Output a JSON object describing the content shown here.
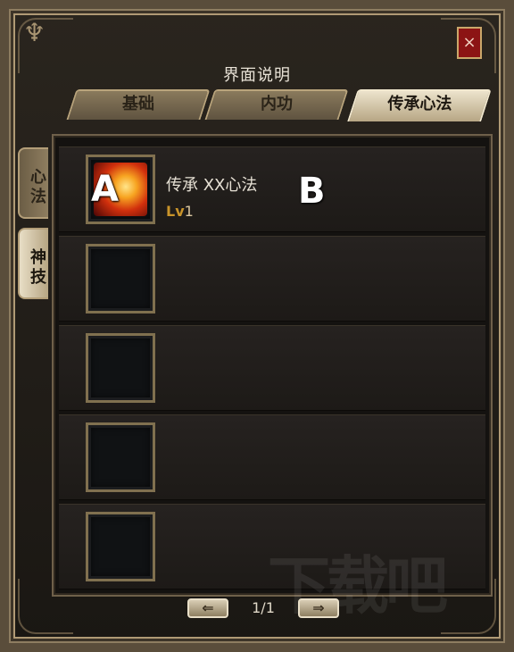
{
  "window": {
    "title": "界面说明",
    "close_label": "×"
  },
  "tabs": [
    {
      "label": "基础",
      "active": false
    },
    {
      "label": "内功",
      "active": false
    },
    {
      "label": "传承心法",
      "active": true
    }
  ],
  "side_tabs": [
    {
      "label": "心法",
      "active": false
    },
    {
      "label": "神技",
      "active": true
    }
  ],
  "skills": [
    {
      "name": "传承 XX心法",
      "level_prefix": "Lv",
      "level": "1",
      "has_icon": true,
      "icon": "fire-skill-icon"
    },
    {
      "name": "",
      "level_prefix": "",
      "level": "",
      "has_icon": false,
      "icon": "empty-slot"
    },
    {
      "name": "",
      "level_prefix": "",
      "level": "",
      "has_icon": false,
      "icon": "empty-slot"
    },
    {
      "name": "",
      "level_prefix": "",
      "level": "",
      "has_icon": false,
      "icon": "empty-slot"
    },
    {
      "name": "",
      "level_prefix": "",
      "level": "",
      "has_icon": false,
      "icon": "empty-slot"
    }
  ],
  "annotations": {
    "a": "A",
    "b": "B"
  },
  "pager": {
    "prev_icon": "⇐",
    "next_icon": "⇒",
    "page_text": "1/1"
  },
  "watermark": "下载吧",
  "colors": {
    "accent": "#c9942a",
    "close": "#8c1414"
  }
}
